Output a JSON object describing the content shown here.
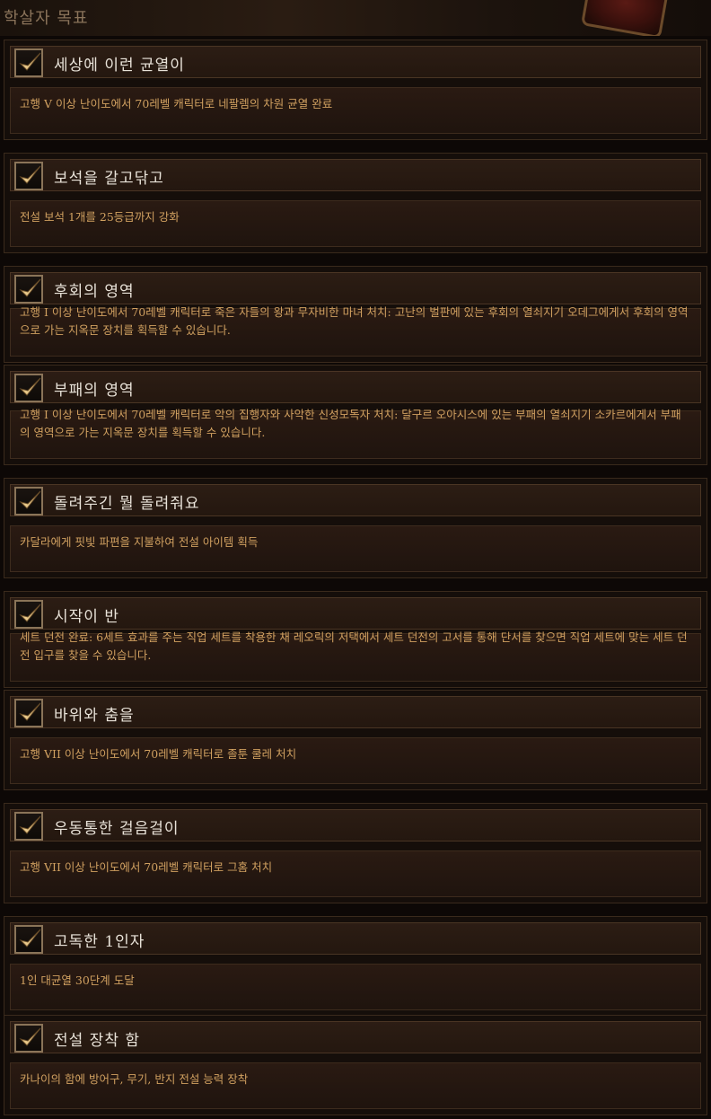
{
  "header": {
    "title": "학살자 목표"
  },
  "colors": {
    "title_text": "#e8e2d8",
    "description_text": "#d0a060",
    "header_text": "#8a735a",
    "checkmark": "#e8c88a"
  },
  "achievements": [
    {
      "title": "세상에 이런 균열이",
      "description": "고행 V 이상 난이도에서 70레벨 캐릭터로 네팔렘의 차원 균열 완료",
      "checked": true
    },
    {
      "title": "보석을 갈고닦고",
      "description": "전설 보석 1개를 25등급까지 강화",
      "checked": true
    },
    {
      "title": "후회의 영역",
      "description": "고행 I 이상 난이도에서 70레벨 캐릭터로 죽은 자들의 왕과 무자비한 마녀 처치: 고난의 벌판에 있는 후회의 열쇠지기 오데그에게서 후회의 영역으로 가는 지옥문 장치를 획득할 수 있습니다.",
      "checked": true
    },
    {
      "title": "부패의 영역",
      "description": "고행 I 이상 난이도에서 70레벨 캐릭터로 악의 집행자와 사악한 신성모독자 처치: 달구르 오아시스에 있는 부패의 열쇠지기 소카르에게서 부패의 영역으로 가는 지옥문 장치를 획득할 수 있습니다.",
      "checked": true
    },
    {
      "title": "돌려주긴 뭘 돌려줘요",
      "description": "카달라에게 핏빛 파편을 지불하여 전설 아이템 획득",
      "checked": true
    },
    {
      "title": "시작이 반",
      "description": "세트 던전 완료: 6세트 효과를 주는 직업 세트를 착용한 채 레오릭의 저택에서 세트 던전의 고서를 통해 단서를 찾으면 직업 세트에 맞는 세트 던전 입구를 찾을 수 있습니다.",
      "checked": true
    },
    {
      "title": "바위와 춤을",
      "description": "고행 VII 이상 난이도에서 70레벨 캐릭터로 졸툰 쿨레 처치",
      "checked": true
    },
    {
      "title": "우동통한 걸음걸이",
      "description": "고행 VII 이상 난이도에서 70레벨 캐릭터로 그홈 처치",
      "checked": true
    },
    {
      "title": "고독한 1인자",
      "description": "1인 대균열 30단계 도달",
      "checked": true
    },
    {
      "title": "전설 장착 함",
      "description": "카나이의 함에 방어구, 무기, 반지 전설 능력 장착",
      "checked": true
    }
  ]
}
